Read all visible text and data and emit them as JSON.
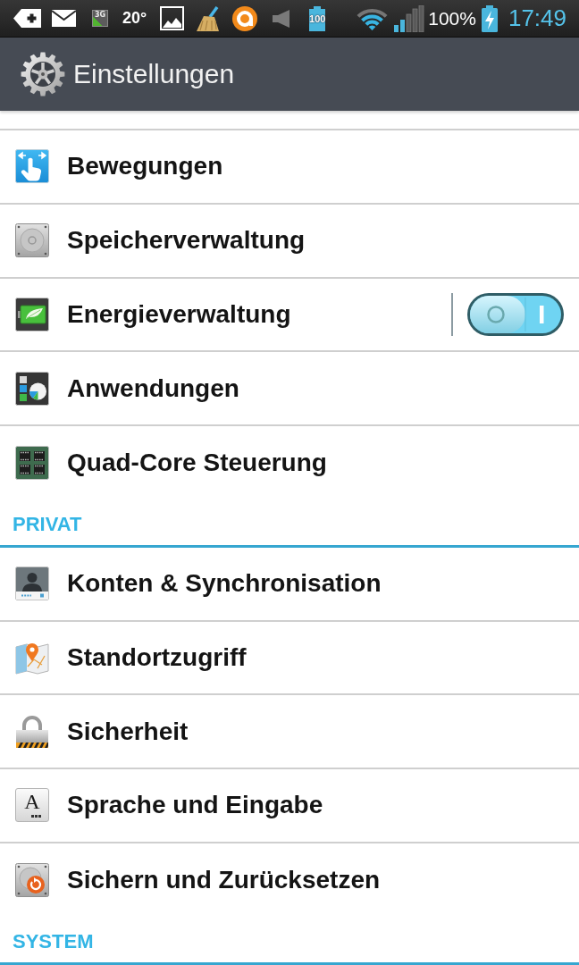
{
  "status_bar": {
    "network_badge": "3G",
    "temperature": "20°",
    "battery_badge": "100",
    "battery_percent": "100%",
    "time": "17:49"
  },
  "action_bar": {
    "title": "Einstellungen"
  },
  "sections": [
    {
      "items": [
        {
          "label": "Bewegungen",
          "kind": "link"
        },
        {
          "label": "Speicherverwaltung",
          "kind": "link"
        },
        {
          "label": "Energieverwaltung",
          "kind": "toggle",
          "on": true
        },
        {
          "label": "Anwendungen",
          "kind": "link"
        },
        {
          "label": "Quad-Core Steuerung",
          "kind": "link"
        }
      ]
    },
    {
      "header": "PRIVAT",
      "items": [
        {
          "label": "Konten & Synchronisation",
          "kind": "link"
        },
        {
          "label": "Standortzugriff",
          "kind": "link"
        },
        {
          "label": "Sicherheit",
          "kind": "link"
        },
        {
          "label": "Sprache und Eingabe",
          "kind": "link",
          "icon_letter": "A"
        },
        {
          "label": "Sichern und Zurücksetzen",
          "kind": "link"
        }
      ]
    },
    {
      "header": "SYSTEM"
    }
  ]
}
